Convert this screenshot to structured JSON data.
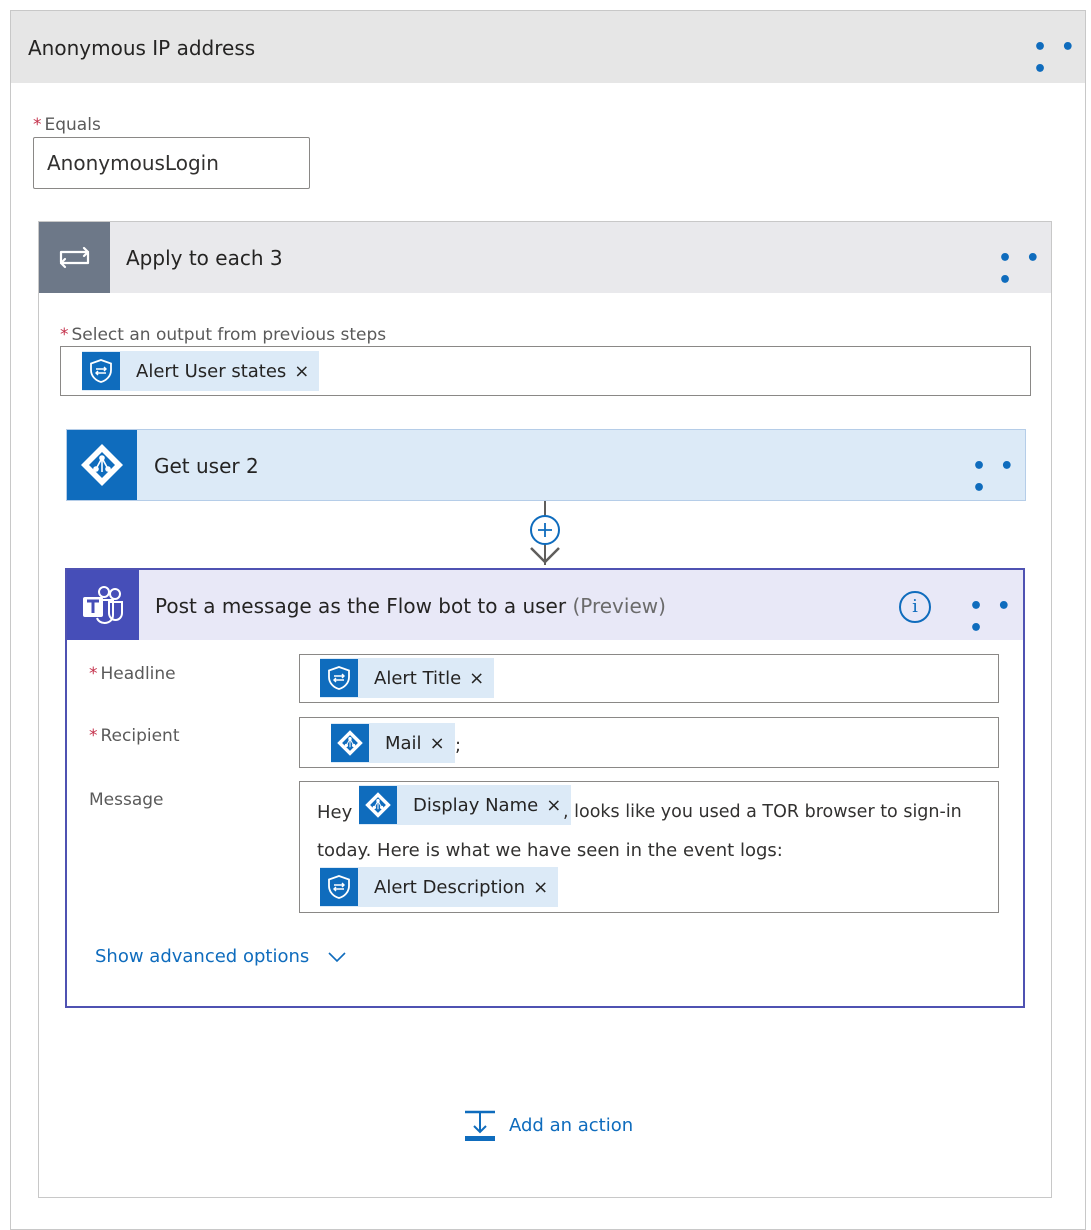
{
  "condition": {
    "title": "Anonymous IP address",
    "more": "• • •",
    "equals_label": "Equals",
    "equals_value": "AnonymousLogin"
  },
  "loop": {
    "title": "Apply to each 3",
    "more": "• • •",
    "select_label": "Select an output from previous steps",
    "select_token": "Alert User states"
  },
  "get_user": {
    "title": "Get user 2",
    "more": "• • •"
  },
  "teams": {
    "title": "Post a message as the Flow bot to a user",
    "preview": "(Preview)",
    "more": "• • •",
    "info": "i",
    "headline_label": "Headline",
    "headline_token": "Alert Title",
    "recipient_label": "Recipient",
    "recipient_token": "Mail",
    "recipient_suffix": ";",
    "message_label": "Message",
    "message_prefix": "Hey",
    "message_token1": "Display Name",
    "message_line1_rest": ", looks like you used a TOR browser to sign-in",
    "message_line2": "today. Here is what we have seen in the event logs:",
    "message_token2": "Alert Description",
    "show_advanced": "Show advanced options"
  },
  "footer": {
    "add_action": "Add an action"
  },
  "common": {
    "required_mark": "*",
    "remove": "×"
  },
  "colors": {
    "accent": "#0f6cbd",
    "teams": "#464eb8",
    "token_bg": "#dceaf7"
  }
}
